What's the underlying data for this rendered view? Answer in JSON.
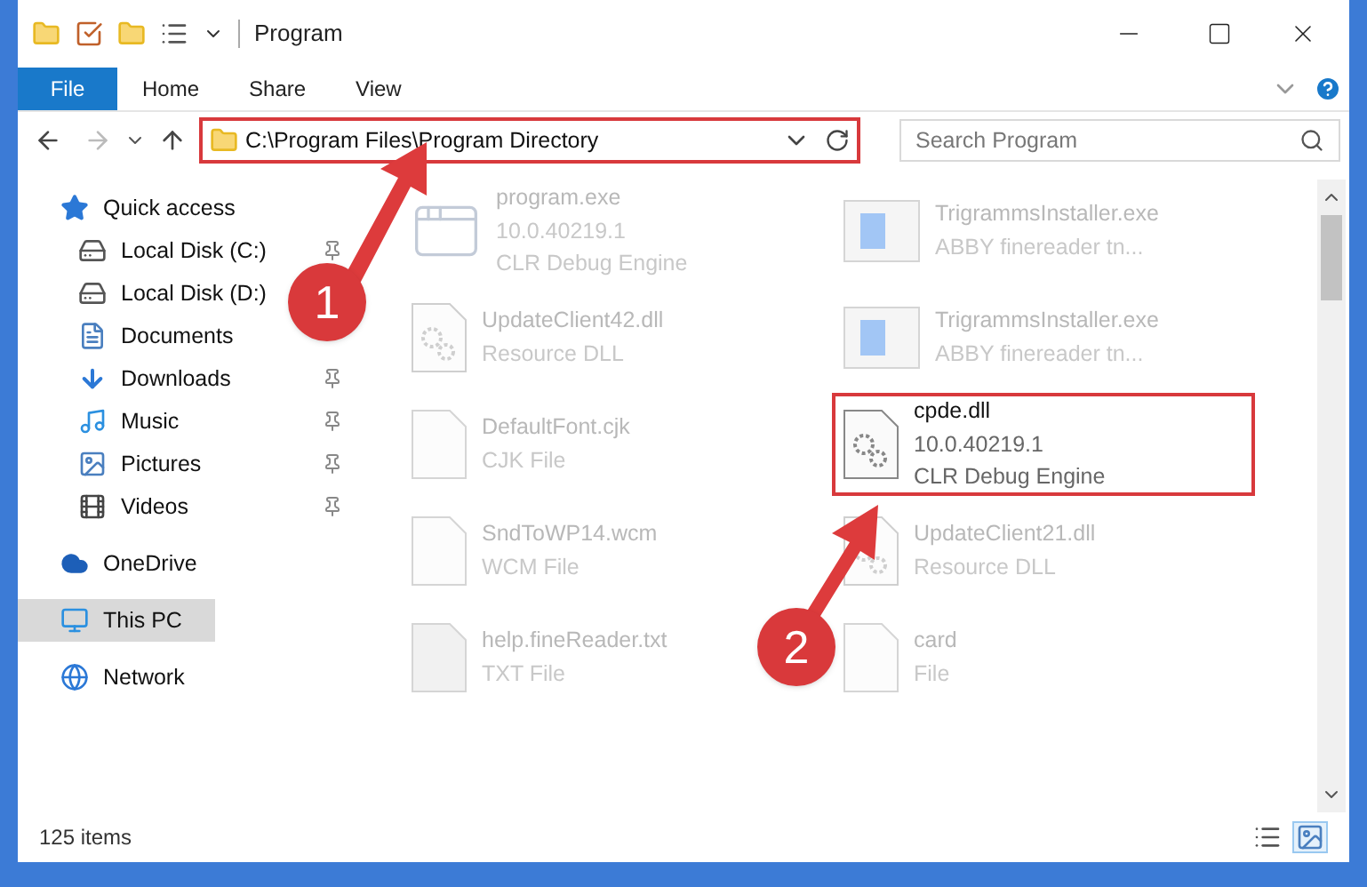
{
  "window": {
    "title": "Program"
  },
  "ribbon_tabs": [
    {
      "label": "File",
      "kind": "file"
    },
    {
      "label": "Home",
      "kind": "tab"
    },
    {
      "label": "Share",
      "kind": "tab"
    },
    {
      "label": "View",
      "kind": "tab"
    }
  ],
  "address_bar": {
    "path": "C:\\Program Files\\Program Directory",
    "highlighted": true
  },
  "search": {
    "placeholder": "Search Program"
  },
  "sidebar": {
    "items": [
      {
        "label": "Quick access",
        "kind": "star",
        "selected": false,
        "children": [
          {
            "label": "Local Disk (C:)",
            "kind": "system_drive",
            "pinned": true,
            "selected": false
          },
          {
            "label": "Local Disk (D:)",
            "kind": "drive",
            "pinned": false,
            "selected": false
          },
          {
            "label": "Documents",
            "kind": "documents",
            "pinned": false,
            "selected": false
          },
          {
            "label": "Downloads",
            "kind": "downloads",
            "pinned": true,
            "selected": false
          },
          {
            "label": "Music",
            "kind": "music",
            "pinned": true,
            "selected": false
          },
          {
            "label": "Pictures",
            "kind": "pictures",
            "pinned": true,
            "selected": false
          },
          {
            "label": "Videos",
            "kind": "videos",
            "pinned": true,
            "selected": false
          }
        ]
      },
      {
        "label": "OneDrive",
        "kind": "cloud",
        "selected": false
      },
      {
        "label": "This PC",
        "kind": "pc",
        "selected": true
      },
      {
        "label": "Network",
        "kind": "network",
        "selected": false
      }
    ]
  },
  "files": [
    {
      "name": "program.exe",
      "details": [
        "10.0.40219.1",
        "CLR Debug Engine"
      ],
      "kind": "app",
      "dimmed": true,
      "highlighted": false
    },
    {
      "name": "UpdateClient42.dll",
      "details": [
        "Resource DLL"
      ],
      "kind": "dll",
      "dimmed": true,
      "highlighted": false
    },
    {
      "name": "DefaultFont.cjk",
      "details": [
        "CJK File"
      ],
      "kind": "file",
      "dimmed": true,
      "highlighted": false
    },
    {
      "name": "SndToWP14.wcm",
      "details": [
        "WCM File"
      ],
      "kind": "file",
      "dimmed": true,
      "highlighted": false
    },
    {
      "name": "help.fineReader.txt",
      "details": [
        "TXT File"
      ],
      "kind": "text",
      "dimmed": true,
      "highlighted": false
    },
    {
      "name": "TrigrammsInstaller.exe",
      "details": [
        "ABBY finereader tn..."
      ],
      "kind": "installer",
      "dimmed": true,
      "highlighted": false
    },
    {
      "name": "TrigrammsInstaller.exe",
      "details": [
        "ABBY finereader tn..."
      ],
      "kind": "installer",
      "dimmed": true,
      "highlighted": false
    },
    {
      "name": "cpde.dll",
      "details": [
        "10.0.40219.1",
        "CLR Debug Engine"
      ],
      "kind": "dll",
      "dimmed": false,
      "highlighted": true
    },
    {
      "name": "UpdateClient21.dll",
      "details": [
        "Resource DLL"
      ],
      "kind": "dll",
      "dimmed": true,
      "highlighted": false
    },
    {
      "name": "card",
      "details": [
        "File"
      ],
      "kind": "file",
      "dimmed": true,
      "highlighted": false
    }
  ],
  "status_bar": {
    "count": "125 items",
    "views": [
      {
        "kind": "details",
        "selected": false
      },
      {
        "kind": "large_icons",
        "selected": true
      }
    ]
  },
  "annotations": [
    {
      "number": "1"
    },
    {
      "number": "2"
    }
  ]
}
